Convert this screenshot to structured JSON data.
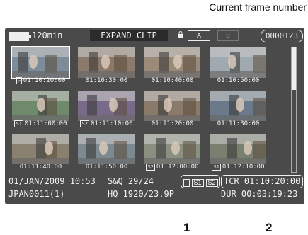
{
  "callouts": {
    "frame_number_label": "Current frame number",
    "n1": "1",
    "n2": "2"
  },
  "status_bar": {
    "battery_time": "120min",
    "mode": "EXPAND CLIP",
    "slot_a": "A",
    "slot_b": "B",
    "frame_number": "0000123"
  },
  "thumbnails": [
    {
      "timecode": "01:10:20:00",
      "badge": "▱",
      "selected": true
    },
    {
      "timecode": "01:10:30:00",
      "badge": ""
    },
    {
      "timecode": "01:10:40:00",
      "badge": ""
    },
    {
      "timecode": "01:10:50:00",
      "badge": ""
    },
    {
      "timecode": "01:11:00:00",
      "badge": "S1"
    },
    {
      "timecode": "01:11:10:00",
      "badge": "S2"
    },
    {
      "timecode": "01:11:20:00",
      "badge": ""
    },
    {
      "timecode": "01:11:30:00",
      "badge": ""
    },
    {
      "timecode": "01:11:40:00",
      "badge": ""
    },
    {
      "timecode": "01:11:50:00",
      "badge": ""
    },
    {
      "timecode": "01:12:00:00",
      "badge": "S2"
    },
    {
      "timecode": "01:12:10:00",
      "badge": "S1"
    }
  ],
  "info": {
    "datetime": "01/JAN/2009 10:53",
    "sq": "S&Q 29/24",
    "clip_name": "JPAN0011(1)",
    "format": "HQ 1920/23.9P",
    "tcr": "TCR 01:10:20:00",
    "dur": "DUR 00:03:19:23",
    "media_s1": "S1",
    "media_s2": "S2"
  }
}
